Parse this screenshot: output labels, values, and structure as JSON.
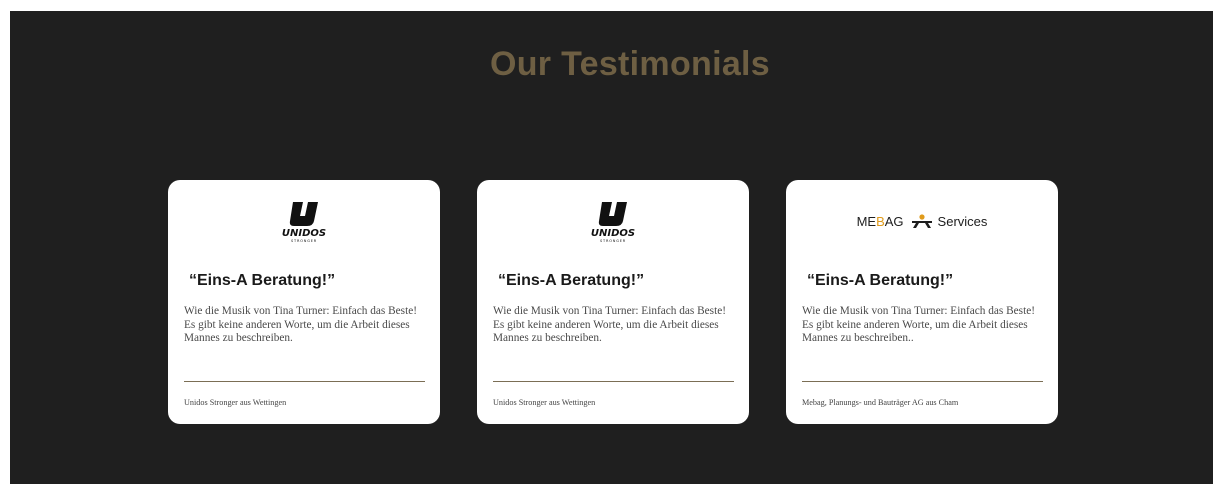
{
  "section": {
    "title": "Our Testimonials"
  },
  "testimonials": [
    {
      "logo_icon": "unidos-stronger-logo-icon",
      "logo_text": "UNIDOS",
      "logo_subtext": "STRONGER",
      "heading": "“Eins-A Beratung!”",
      "text": "Wie die Musik von Tina Turner: Einfach das Beste! Es gibt keine anderen Worte, um die Arbeit dieses Mannes zu beschreiben.",
      "author": "Unidos Stronger aus Wettingen"
    },
    {
      "logo_icon": "unidos-stronger-logo-icon",
      "logo_text": "UNIDOS",
      "logo_subtext": "STRONGER",
      "heading": "“Eins-A Beratung!”",
      "text": "Wie die Musik von Tina Turner: Einfach das Beste! Es gibt keine anderen Worte, um die Arbeit dieses Mannes zu beschreiben.",
      "author": "Unidos Stronger aus Wettingen"
    },
    {
      "logo_icon": "mebag-services-logo-icon",
      "logo_text_a": "ME",
      "logo_text_b": "B",
      "logo_text_c": "AG",
      "logo_services": "Services",
      "heading": "“Eins-A Beratung!”",
      "text": "Wie die Musik von Tina Turner: Einfach das Beste! Es gibt keine anderen Worte, um die Arbeit dieses Mannes zu beschreiben..",
      "author": "Mebag, Planungs- und Bauträger AG aus Cham"
    }
  ],
  "colors": {
    "background": "#1f1f1f",
    "title": "#6e5f43",
    "card": "#ffffff",
    "divider": "#7b6e55",
    "mebag_accent": "#e09b1b"
  }
}
